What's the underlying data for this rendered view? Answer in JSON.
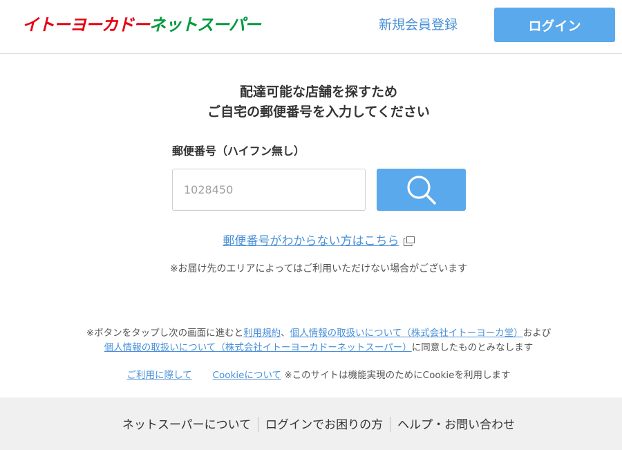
{
  "header": {
    "logo_part1": "イトーヨーカドー",
    "logo_part2": "ネットスーパー",
    "register_label": "新規会員登録",
    "login_label": "ログイン"
  },
  "main": {
    "heading_line1": "配達可能な店舗を探すため",
    "heading_line2": "ご自宅の郵便番号を入力してください",
    "postal_label": "郵便番号（ハイフン無し）",
    "postal_placeholder": "1028450",
    "postal_value": "",
    "search_icon": "search-icon",
    "help_link": "郵便番号がわからない方はこちら",
    "area_note": "※お届け先のエリアによってはご利用いただけない場合がございます"
  },
  "consent": {
    "prefix": "※ボタンをタップし次の画面に進むと",
    "terms_link": "利用規約",
    "comma": "、",
    "privacy_link_1": "個人情報の取扱いについて（株式会社イトーヨーカ堂）",
    "and": "および",
    "privacy_link_2": "個人情報の取扱いについて（株式会社イトーヨーカドーネットスーパー）",
    "suffix": "に同意したものとみなします"
  },
  "cookie": {
    "usage_link": "ご利用に際して",
    "cookie_link": "Cookieについて",
    "note": "※このサイトは機能実現のためにCookieを利用します"
  },
  "footer": {
    "items": [
      "ネットスーパーについて",
      "ログインでお困りの方",
      "ヘルプ・お問い合わせ"
    ]
  },
  "colors": {
    "accent": "#5aa9ec",
    "link": "#4a90d9",
    "logo_red": "#e60012",
    "logo_green": "#009a3e",
    "footer_bg": "#f0f0f0"
  }
}
